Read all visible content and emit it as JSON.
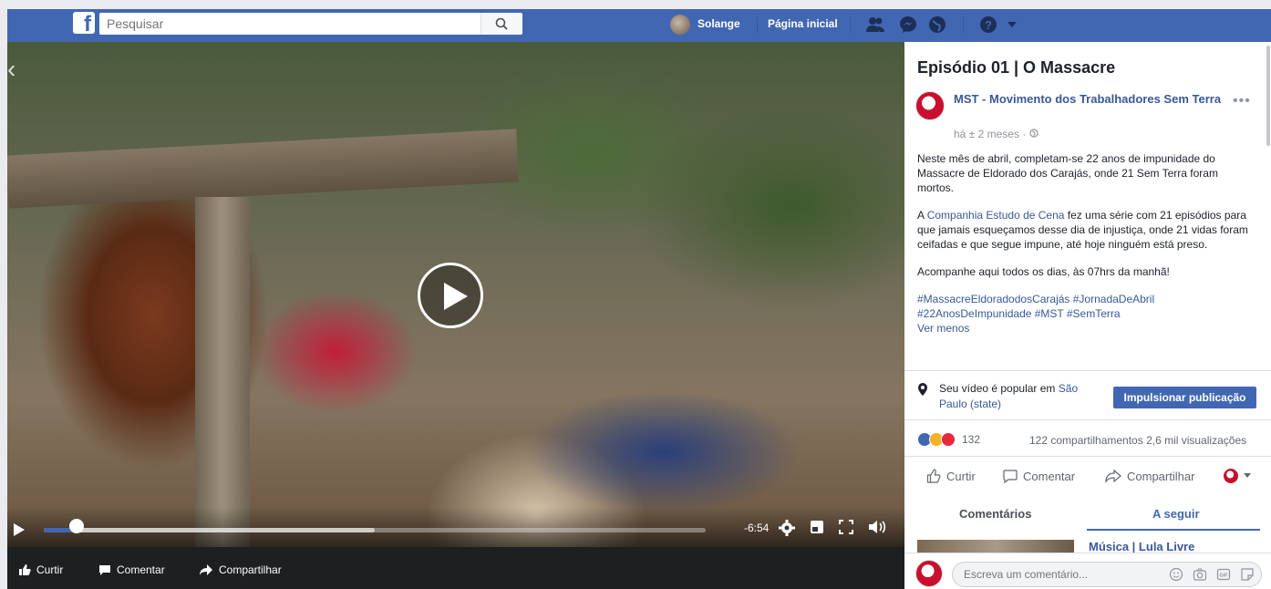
{
  "topbar": {
    "search_placeholder": "Pesquisar",
    "user_name": "Solange",
    "home_label": "Página inicial",
    "brand_color": "#4267b2",
    "icons": [
      "friends-icon",
      "messenger-icon",
      "globe-icon",
      "help-icon",
      "caret-down-icon"
    ]
  },
  "video": {
    "time_remaining": "-6:54",
    "progress": 0.05,
    "buffered": 0.5,
    "actions": {
      "like": "Curtir",
      "comment": "Comentar",
      "share": "Compartilhar"
    }
  },
  "post": {
    "title": "Episódio 01 | O Massacre",
    "page_name": "MST - Movimento dos Trabalhadores Sem Terra",
    "time": "há ± 2 meses · ",
    "paragraph1": "Neste mês de abril, completam-se 22 anos de impunidade do Massacre de Eldorado dos Carajás, onde 21 Sem Terra foram mortos.",
    "paragraph2_prefix": "A ",
    "paragraph2_link": "Companhia Estudo de Cena",
    "paragraph2_suffix": " fez uma série com 21 episódios para que jamais esqueçamos desse dia de injustiça, onde 21 vidas foram ceifadas e que segue impune, até hoje ninguém está preso.",
    "paragraph3": "Acompanhe aqui todos os dias, às 07hrs da manhã!",
    "hashtags_line1": "#MassacreEldoradodosCarajás #JornadaDeAbril",
    "hashtags_line2": "#22AnosDeImpunidade #MST #SemTerra",
    "see_less": "Ver menos"
  },
  "popular": {
    "text_prefix": "Seu vídeo é popular em ",
    "text_link": "São Paulo (state)",
    "boost_label": "Impulsionar publicação"
  },
  "stats": {
    "reactions_count": "132",
    "shares_views": "122 compartilhamentos  2,6 mil visualizações"
  },
  "post_actions": {
    "like": "Curtir",
    "comment": "Comentar",
    "share": "Compartilhar"
  },
  "tabs": {
    "comments": "Comentários",
    "next": "A seguir"
  },
  "next_item": {
    "title": "Música | Lula Livre"
  },
  "comment_box": {
    "placeholder": "Escreva um comentário..."
  }
}
